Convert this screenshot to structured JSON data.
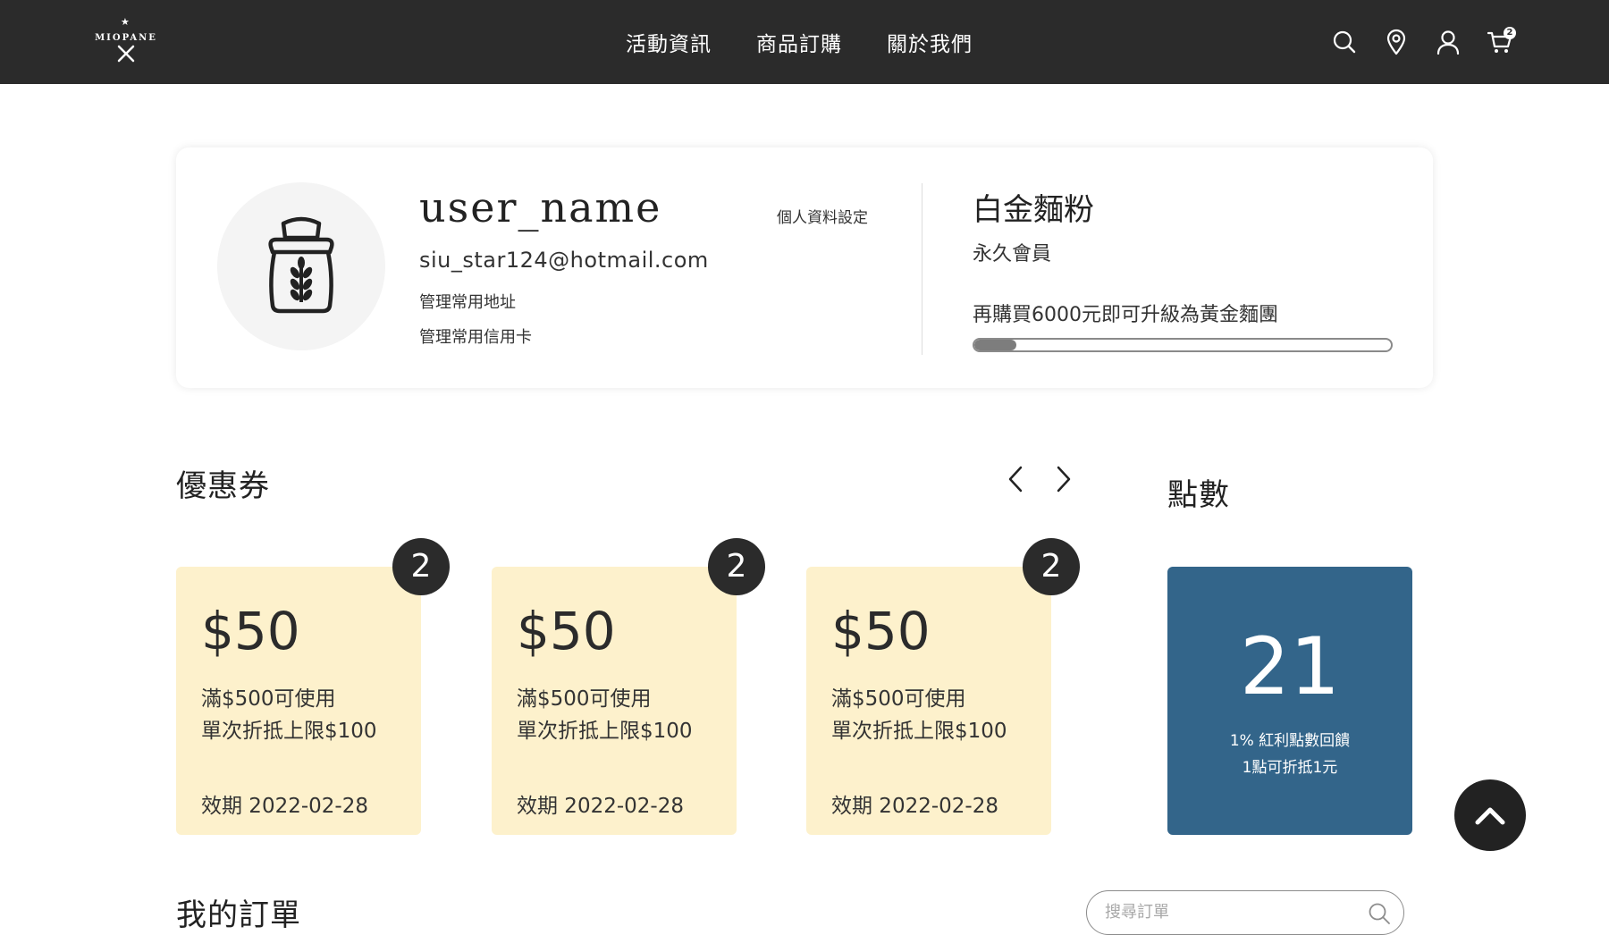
{
  "header": {
    "logo_text": "MIOPANE",
    "nav": [
      {
        "label": "活動資訊"
      },
      {
        "label": "商品訂購"
      },
      {
        "label": "關於我們"
      }
    ],
    "icons": [
      "search-icon",
      "location-pin-icon",
      "user-icon",
      "cart-icon"
    ],
    "cart_count": "2",
    "background": "#2b2b2b"
  },
  "profile": {
    "username": "user_name",
    "email": "siu_star124@hotmail.com",
    "settings_label": "個人資料設定",
    "manage_address_label": "管理常用地址",
    "manage_card_label": "管理常用信用卡",
    "avatar_icon": "flour-bag-icon"
  },
  "membership": {
    "tier": "白金麵粉",
    "tier_sub": "永久會員",
    "upgrade_text": "再購買6000元即可升級為黃金麵團",
    "progress_fraction": 0.1
  },
  "coupons": {
    "title": "優惠券",
    "items": [
      {
        "amount": "$50",
        "condition": "滿$500可使用",
        "limit": "單次折抵上限$100",
        "expiry": "效期 2022-02-28",
        "count": "2"
      },
      {
        "amount": "$50",
        "condition": "滿$500可使用",
        "limit": "單次折抵上限$100",
        "expiry": "效期 2022-02-28",
        "count": "2"
      },
      {
        "amount": "$50",
        "condition": "滿$500可使用",
        "limit": "單次折抵上限$100",
        "expiry": "效期 2022-02-28",
        "count": "2"
      }
    ],
    "card_color": "#fdf1cc"
  },
  "points": {
    "title": "點數",
    "value": "21",
    "note1": "1% 紅利點數回饋",
    "note2": "1點可折抵1元",
    "box_color": "#33658a"
  },
  "orders": {
    "title": "我的訂單",
    "search_placeholder": "搜尋訂單",
    "search_value": ""
  }
}
